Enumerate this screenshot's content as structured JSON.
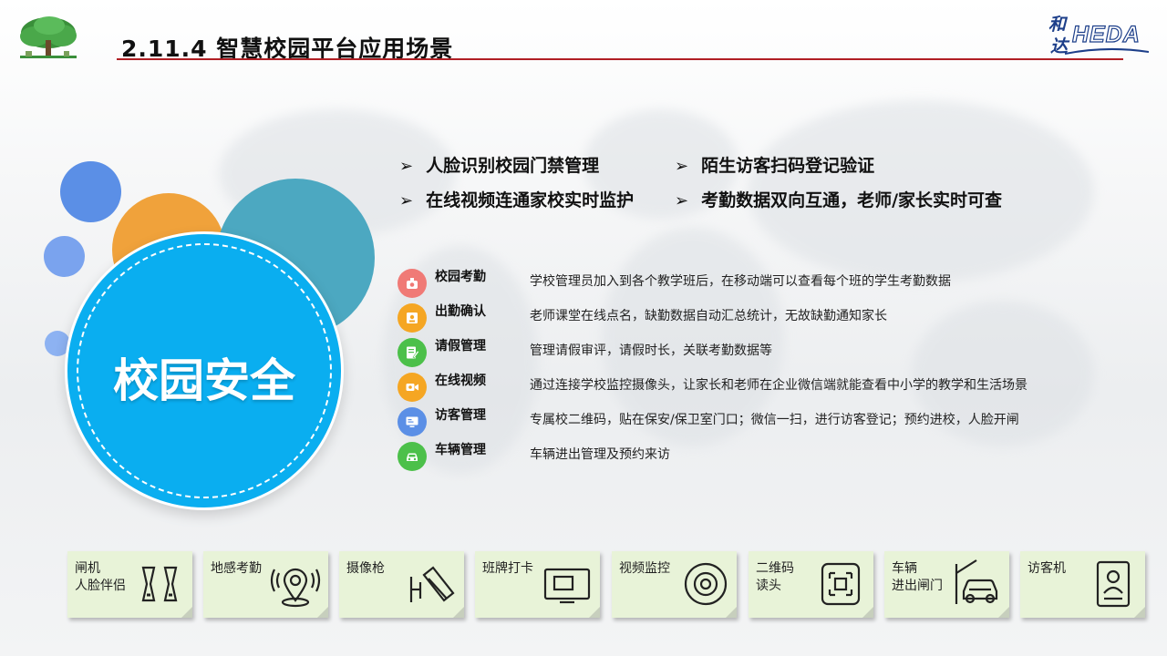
{
  "header": {
    "title": "2.11.4  智慧校园平台应用场景",
    "brand_cn_1": "和",
    "brand_cn_2": "达",
    "brand_en": "HEDA",
    "logo_icon": "tree-icon"
  },
  "hero": {
    "label": "校园安全"
  },
  "bullets": [
    "人脸识别校园门禁管理",
    "陌生访客扫码登记验证",
    "在线视频连通家校实时监护",
    "考勤数据双向互通，老师/家长实时可查"
  ],
  "bullet_arrow": "➢",
  "features": [
    {
      "name": "校园考勤",
      "desc": "学校管理员加入到各个教学班后，在移动端可以查看每个班的学生考勤数据",
      "icon": "attendance-icon",
      "color": "#f07a76"
    },
    {
      "name": "出勤确认",
      "desc": "老师课堂在线点名，缺勤数据自动汇总统计，无故缺勤通知家长",
      "icon": "id-card-icon",
      "color": "#f5a623"
    },
    {
      "name": "请假管理",
      "desc": "管理请假审评，请假时长，关联考勤数据等",
      "icon": "document-edit-icon",
      "color": "#4cc04a"
    },
    {
      "name": "在线视频",
      "desc": "通过连接学校监控摄像头，让家长和老师在企业微信端就能查看中小学的教学和生活场景",
      "icon": "video-camera-icon",
      "color": "#f5a623"
    },
    {
      "name": "访客管理",
      "desc": "专属校二维码，贴在保安/保卫室门口；微信一扫，进行访客登记；预约进校，人脸开闸",
      "icon": "visitor-terminal-icon",
      "color": "#5b8fe6"
    },
    {
      "name": "车辆管理",
      "desc": "车辆进出管理及预约来访",
      "icon": "car-icon",
      "color": "#4cc04a"
    }
  ],
  "devices": [
    {
      "line1": "闸机",
      "line2": "人脸伴侣",
      "icon": "turnstile-icon"
    },
    {
      "line1": "地感考勤",
      "line2": "",
      "icon": "location-signal-icon"
    },
    {
      "line1": "摄像枪",
      "line2": "",
      "icon": "bullet-camera-icon"
    },
    {
      "line1": "班牌打卡",
      "line2": "",
      "icon": "class-board-icon"
    },
    {
      "line1": "视频监控",
      "line2": "",
      "icon": "dome-camera-icon"
    },
    {
      "line1": "二维码",
      "line2": "读头",
      "icon": "qr-reader-icon"
    },
    {
      "line1": "车辆",
      "line2": "进出闸门",
      "icon": "car-gate-icon"
    },
    {
      "line1": "访客机",
      "line2": "",
      "icon": "visitor-kiosk-icon"
    }
  ],
  "colors": {
    "title_line": "#b01f24",
    "hero_circle": "#0aaef0",
    "card_bg": "#e8f3d8",
    "brand": "#1d3f8a"
  }
}
